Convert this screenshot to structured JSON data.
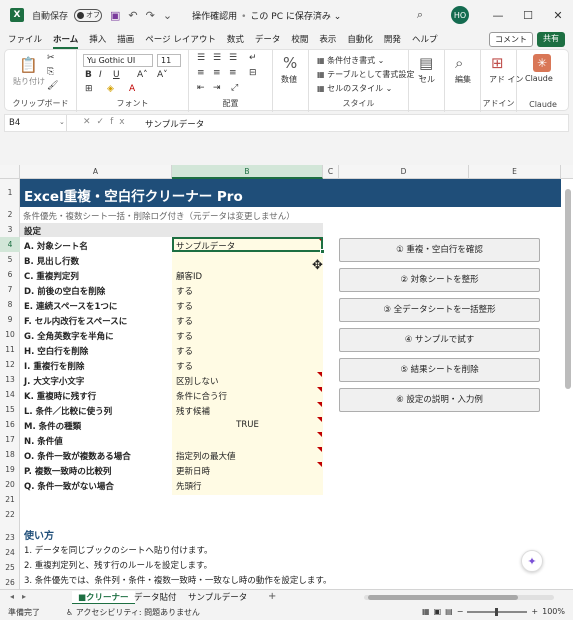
{
  "titlebar": {
    "app_letter": "X",
    "autosave_label": "自動保存",
    "autosave_state": "オフ",
    "doc_title": "操作確認用",
    "doc_status": "この PC に保存済み",
    "user_initials": "HO"
  },
  "menu": {
    "tabs": [
      "ファイル",
      "ホーム",
      "挿入",
      "描画",
      "ページ レイアウト",
      "数式",
      "データ",
      "校閲",
      "表示",
      "自動化",
      "開発",
      "ヘルプ"
    ],
    "active_tab": "ホーム",
    "comment_label": "コメント",
    "share_label": "共有"
  },
  "ribbon": {
    "paste_label": "貼り付け",
    "clipboard_label": "クリップボード",
    "font_name": "Yu Gothic UI",
    "font_size": "11",
    "font_label": "フォント",
    "bold": "B",
    "italic": "I",
    "underline": "U",
    "align_label": "配置",
    "number_label": "数値",
    "cond_format": "条件付き書式",
    "table_format": "テーブルとして書式設定",
    "cell_style": "セルのスタイル",
    "style_label": "スタイル",
    "cell_label": "セル",
    "edit_label": "編集",
    "addin_label": "アド イン",
    "addin_group": "アドイン",
    "claude_label": "Claude",
    "claude_group": "Claude"
  },
  "formula": {
    "name_box": "B4",
    "value": "サンプルデータ"
  },
  "columns": [
    "A",
    "B",
    "C",
    "D",
    "E"
  ],
  "rows": [
    "1",
    "2",
    "3",
    "4",
    "5",
    "6",
    "7",
    "8",
    "9",
    "10",
    "11",
    "12",
    "13",
    "14",
    "15",
    "16",
    "17",
    "18",
    "19",
    "20",
    "21",
    "22",
    "23",
    "24",
    "25",
    "26"
  ],
  "sheet": {
    "title": "Excel重複・空白行クリーナー Pro",
    "subtitle": "条件優先・複数シート一括・削除ログ付き（元データは変更しません）",
    "settings_header": "設定",
    "settings": [
      {
        "label": "A. 対象シート名",
        "value": "サンプルデータ"
      },
      {
        "label": "B. 見出し行数",
        "value": ""
      },
      {
        "label": "C. 重複判定列",
        "value": "顧客ID"
      },
      {
        "label": "D. 前後の空白を削除",
        "value": "する"
      },
      {
        "label": "E. 連続スペースを1つに",
        "value": "する"
      },
      {
        "label": "F. セル内改行をスペースに",
        "value": "する"
      },
      {
        "label": "G. 全角英数字を半角に",
        "value": "する"
      },
      {
        "label": "H. 空白行を削除",
        "value": "する"
      },
      {
        "label": "I. 重複行を削除",
        "value": "する"
      },
      {
        "label": "J. 大文字小文字",
        "value": "区別しない"
      },
      {
        "label": "K. 重複時に残す行",
        "value": "条件に合う行"
      },
      {
        "label": "L. 条件／比較に使う列",
        "value": "残す候補"
      },
      {
        "label": "M. 条件の種類",
        "value": "TRUE"
      },
      {
        "label": "N. 条件値",
        "value": ""
      },
      {
        "label": "O. 条件一致が複数ある場合",
        "value": "指定列の最大値"
      },
      {
        "label": "P. 複数一致時の比較列",
        "value": "更新日時"
      },
      {
        "label": "Q. 条件一致がない場合",
        "value": "先頭行"
      }
    ],
    "buttons": [
      "① 重複・空白行を確認",
      "② 対象シートを整形",
      "③ 全データシートを一括整形",
      "④ サンプルで試す",
      "⑤ 結果シートを削除",
      "⑥ 設定の説明・入力例"
    ],
    "howto_header": "使い方",
    "howto": [
      "1. データを同じブックのシートへ貼り付けます。",
      "2. 重複判定列と、残す行のルールを設定します。",
      "3. 条件優先では、条件列・条件・複数一致時・一致なし時の動作を設定します。"
    ]
  },
  "tabs": {
    "items": [
      "■クリーナー",
      "データ貼付",
      "サンプルデータ"
    ],
    "active": "■クリーナー"
  },
  "status": {
    "ready": "準備完了",
    "accessibility": "アクセシビリティ: 問題ありません",
    "zoom": "100%"
  },
  "colors": {
    "accent": "#1d6f42",
    "title_band": "#1f4e79",
    "input_band": "#fffbe4",
    "comment_marker": "#c00000"
  }
}
